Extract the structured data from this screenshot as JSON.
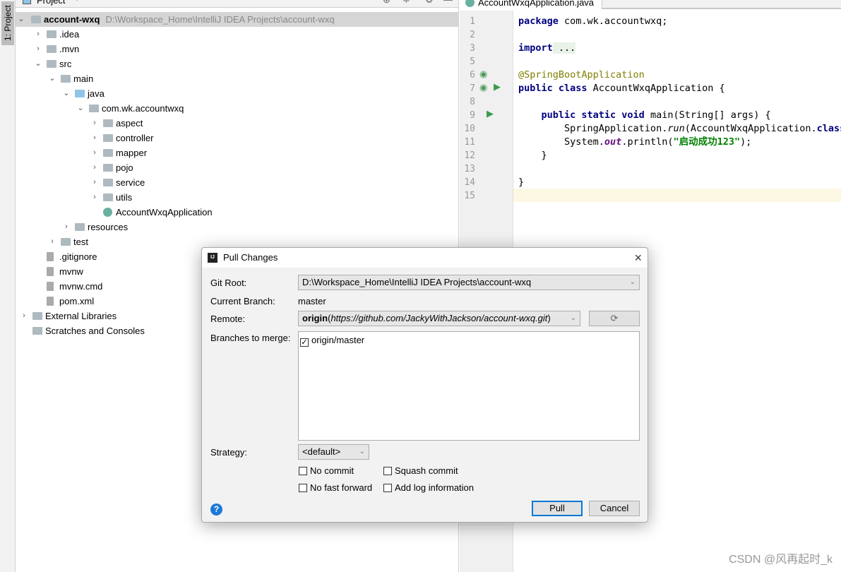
{
  "toolwindow_strip": {
    "label": "1: Project"
  },
  "project": {
    "header": "Project",
    "root": {
      "name": "account-wxq",
      "path": "D:\\Workspace_Home\\IntelliJ IDEA Projects\\account-wxq"
    },
    "items": [
      {
        "label": ".idea",
        "level": 1,
        "arrow": "›"
      },
      {
        "label": ".mvn",
        "level": 1,
        "arrow": "›"
      },
      {
        "label": "src",
        "level": 1,
        "arrow": "⌄"
      },
      {
        "label": "main",
        "level": 2,
        "arrow": "⌄"
      },
      {
        "label": "java",
        "level": 3,
        "arrow": "⌄"
      },
      {
        "label": "com.wk.accountwxq",
        "level": 4,
        "arrow": "⌄"
      },
      {
        "label": "aspect",
        "level": 5,
        "arrow": "›"
      },
      {
        "label": "controller",
        "level": 5,
        "arrow": "›"
      },
      {
        "label": "mapper",
        "level": 5,
        "arrow": "›"
      },
      {
        "label": "pojo",
        "level": 5,
        "arrow": "›"
      },
      {
        "label": "service",
        "level": 5,
        "arrow": "›"
      },
      {
        "label": "utils",
        "level": 5,
        "arrow": "›"
      },
      {
        "label": "AccountWxqApplication",
        "level": 5,
        "arrow": ""
      },
      {
        "label": "resources",
        "level": 3,
        "arrow": "›"
      },
      {
        "label": "test",
        "level": 2,
        "arrow": "›"
      },
      {
        "label": ".gitignore",
        "level": 1,
        "arrow": ""
      },
      {
        "label": "mvnw",
        "level": 1,
        "arrow": ""
      },
      {
        "label": "mvnw.cmd",
        "level": 1,
        "arrow": ""
      },
      {
        "label": "pom.xml",
        "level": 1,
        "arrow": ""
      },
      {
        "label": "External Libraries",
        "level": 0,
        "arrow": "›"
      },
      {
        "label": "Scratches and Consoles",
        "level": 0,
        "arrow": ""
      }
    ]
  },
  "editor": {
    "tab": "AccountWxqApplication.java",
    "line_numbers": [
      "1",
      "2",
      "3",
      "5",
      "6",
      "7",
      "8",
      "9",
      "10",
      "11",
      "12",
      "13",
      "14",
      "15"
    ],
    "code": {
      "l1a": "package",
      "l1b": " com.wk.accountwxq;",
      "l3a": "import",
      "l3b": " ...",
      "l6": "@SpringBootApplication",
      "l7a": "public class",
      "l7b": " AccountWxqApplication {",
      "l9a": "    public static void",
      "l9b": " main(String[] args) {",
      "l10a": "        SpringApplication.",
      "l10b": "run",
      "l10c": "(AccountWxqApplication.",
      "l10d": "class",
      "l11a": "        System.",
      "l11b": "out",
      "l11c": ".println(",
      "l11d": "\"启动成功123\"",
      "l11e": ");",
      "l12": "    }",
      "l14": "}"
    }
  },
  "dialog": {
    "title": "Pull Changes",
    "git_root_label": "Git Root:",
    "git_root_value": "D:\\Workspace_Home\\IntelliJ IDEA Projects\\account-wxq",
    "current_branch_label": "Current Branch:",
    "current_branch_value": "master",
    "remote_label": "Remote:",
    "remote_name": "origin",
    "remote_url": "https://github.com/JackyWithJackson/account-wxq.git",
    "branches_label": "Branches to merge:",
    "branches": [
      {
        "name": "origin/master",
        "checked": true
      }
    ],
    "strategy_label": "Strategy:",
    "strategy_value": "<default>",
    "options": {
      "no_commit": "No commit",
      "squash_commit": "Squash commit",
      "no_fast_forward": "No fast forward",
      "add_log": "Add log information"
    },
    "pull": "Pull",
    "cancel": "Cancel"
  },
  "watermark": "CSDN @风再起时_k"
}
